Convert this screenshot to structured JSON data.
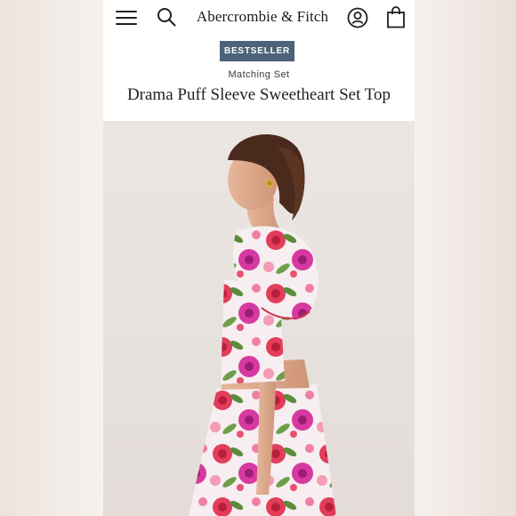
{
  "header": {
    "brand": "Abercrombie & Fitch",
    "icons": {
      "menu": "hamburger-menu-icon",
      "search": "search-icon",
      "account": "account-icon",
      "bag": "shopping-bag-icon"
    }
  },
  "product": {
    "badge": "BESTSELLER",
    "category": "Matching Set",
    "name": "Drama Puff Sleeve Sweetheart Set Top"
  },
  "colors": {
    "badge_bg": "#4c6379",
    "text": "#1a1a1a",
    "hero_bg": "#e8e2de"
  }
}
